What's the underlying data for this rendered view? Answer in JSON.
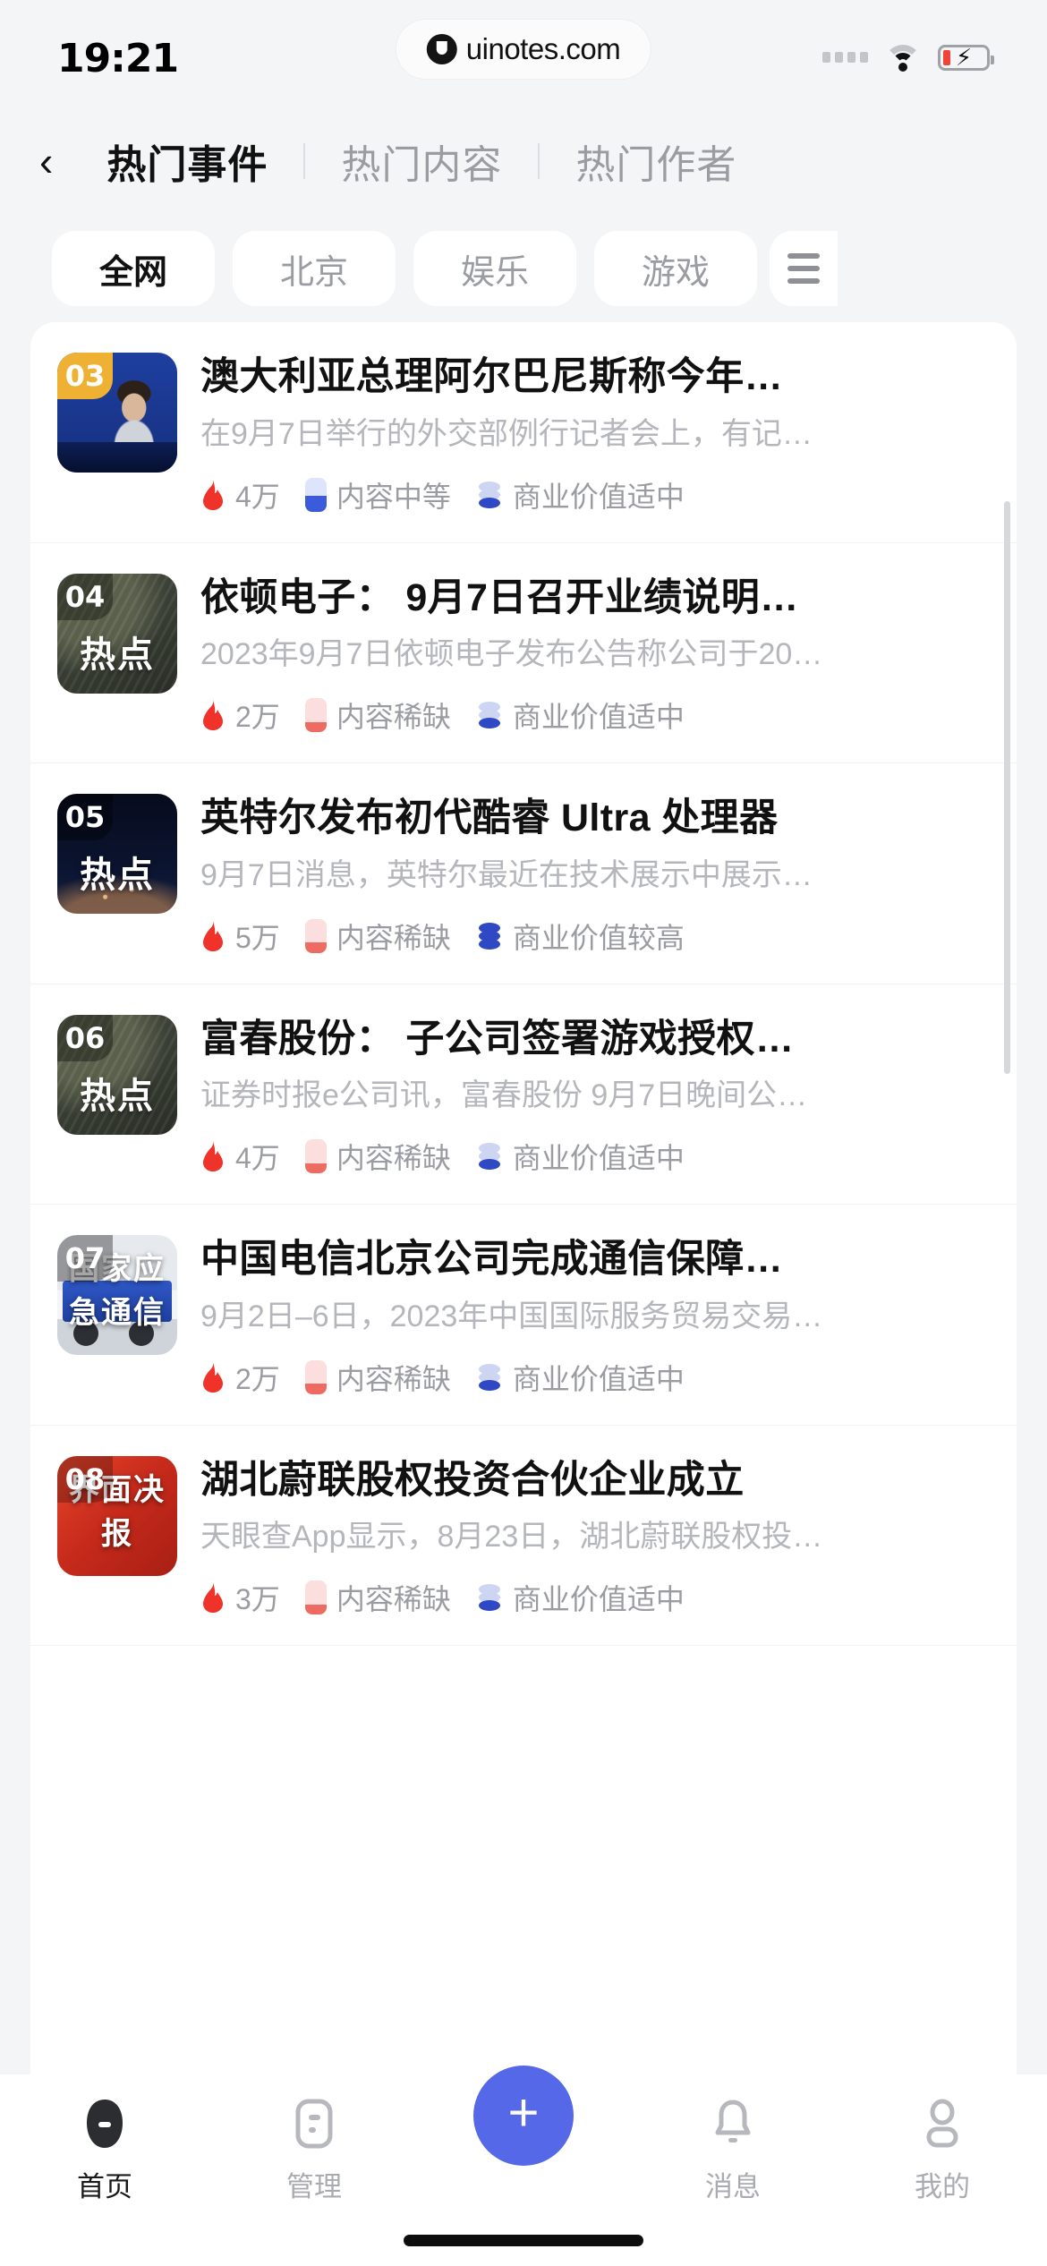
{
  "status_bar": {
    "time": "19:21",
    "watermark": "uinotes.com",
    "watermark_logo_icon": "uinotes-logo-icon",
    "signal_icon": "signal-dots-icon",
    "wifi_icon": "wifi-icon",
    "battery_icon": "battery-charging-icon"
  },
  "header": {
    "back_icon": "chevron-left-icon",
    "tabs": [
      {
        "label": "热门事件",
        "active": true
      },
      {
        "label": "热门内容",
        "active": false
      },
      {
        "label": "热门作者",
        "active": false
      }
    ]
  },
  "filters": {
    "chips": [
      {
        "label": "全网",
        "active": true
      },
      {
        "label": "北京",
        "active": false
      },
      {
        "label": "娱乐",
        "active": false
      },
      {
        "label": "游戏",
        "active": false
      }
    ],
    "menu_icon": "hamburger-menu-icon"
  },
  "list": {
    "items": [
      {
        "rank": "03",
        "thumb_art": "art-gov",
        "thumb_badge_color": "#efb134",
        "thumb_caption": "",
        "thumb_caption_sub": "",
        "title": "澳大利亚总理阿尔巴尼斯称今年…",
        "snippet": "在9月7日举行的外交部例行记者会上，有记…",
        "heat_icon": "flame-icon",
        "heat": "4万",
        "content_level_icon": "content-level-medium-icon",
        "content_level": "内容中等",
        "content_level_class": "lv-mid",
        "value_icon": "commercial-value-icon",
        "value": "商业价值适中",
        "value_fill": 1
      },
      {
        "rank": "04",
        "thumb_art": "art-olive",
        "thumb_badge_color": "rgba(0,0,0,0.35)",
        "thumb_caption": "热点",
        "thumb_caption_sub": "",
        "title": "依顿电子：  9月7日召开业绩说明…",
        "snippet": "2023年9月7日依顿电子发布公告称公司于20…",
        "heat_icon": "flame-icon",
        "heat": "2万",
        "content_level_icon": "content-level-low-icon",
        "content_level": "内容稀缺",
        "content_level_class": "lv-low",
        "value_icon": "commercial-value-icon",
        "value": "商业价值适中",
        "value_fill": 1
      },
      {
        "rank": "05",
        "thumb_art": "art-space",
        "thumb_badge_color": "rgba(0,0,0,0.35)",
        "thumb_caption": "热点",
        "thumb_caption_sub": "",
        "title": "英特尔发布初代酷睿 Ultra 处理器",
        "snippet": "9月7日消息，英特尔最近在技术展示中展示…",
        "heat_icon": "flame-icon",
        "heat": "5万",
        "content_level_icon": "content-level-low-icon",
        "content_level": "内容稀缺",
        "content_level_class": "lv-low",
        "value_icon": "commercial-value-icon",
        "value": "商业价值较高",
        "value_fill": 2
      },
      {
        "rank": "06",
        "thumb_art": "art-olive",
        "thumb_badge_color": "rgba(0,0,0,0.35)",
        "thumb_caption": "热点",
        "thumb_caption_sub": "",
        "title": "富春股份：  子公司签署游戏授权…",
        "snippet": "证券时报e公司讯，富春股份 9月7日晚间公…",
        "heat_icon": "flame-icon",
        "heat": "4万",
        "content_level_icon": "content-level-low-icon",
        "content_level": "内容稀缺",
        "content_level_class": "lv-low",
        "value_icon": "commercial-value-icon",
        "value": "商业价值适中",
        "value_fill": 1
      },
      {
        "rank": "07",
        "thumb_art": "art-truck",
        "thumb_badge_color": "rgba(0,0,0,0.35)",
        "thumb_caption": "国家应急通信",
        "thumb_caption_sub": "",
        "title": "中国电信北京公司完成通信保障…",
        "snippet": "9月2日–6日，2023年中国国际服务贸易交易…",
        "heat_icon": "flame-icon",
        "heat": "2万",
        "content_level_icon": "content-level-low-icon",
        "content_level": "内容稀缺",
        "content_level_class": "lv-low",
        "value_icon": "commercial-value-icon",
        "value": "商业价值适中",
        "value_fill": 1
      },
      {
        "rank": "08",
        "thumb_art": "art-red",
        "thumb_badge_color": "rgba(0,0,0,0.25)",
        "thumb_caption": "界面决报",
        "thumb_caption_sub": "",
        "title": "湖北蔚联股权投资合伙企业成立",
        "snippet": "天眼查App显示，8月23日，湖北蔚联股权投…",
        "heat_icon": "flame-icon",
        "heat": "3万",
        "content_level_icon": "content-level-low-icon",
        "content_level": "内容稀缺",
        "content_level_class": "lv-low",
        "value_icon": "commercial-value-icon",
        "value": "商业价值适中",
        "value_fill": 1
      }
    ]
  },
  "bottom_nav": {
    "items": [
      {
        "label": "首页",
        "icon": "home-icon",
        "active": true
      },
      {
        "label": "管理",
        "icon": "list-manage-icon",
        "active": false
      },
      {
        "label": "消息",
        "icon": "bell-icon",
        "active": false
      },
      {
        "label": "我的",
        "icon": "person-icon",
        "active": false
      }
    ],
    "fab": {
      "icon": "plus-icon",
      "label": "+"
    },
    "accent_color": "#5468e8"
  }
}
